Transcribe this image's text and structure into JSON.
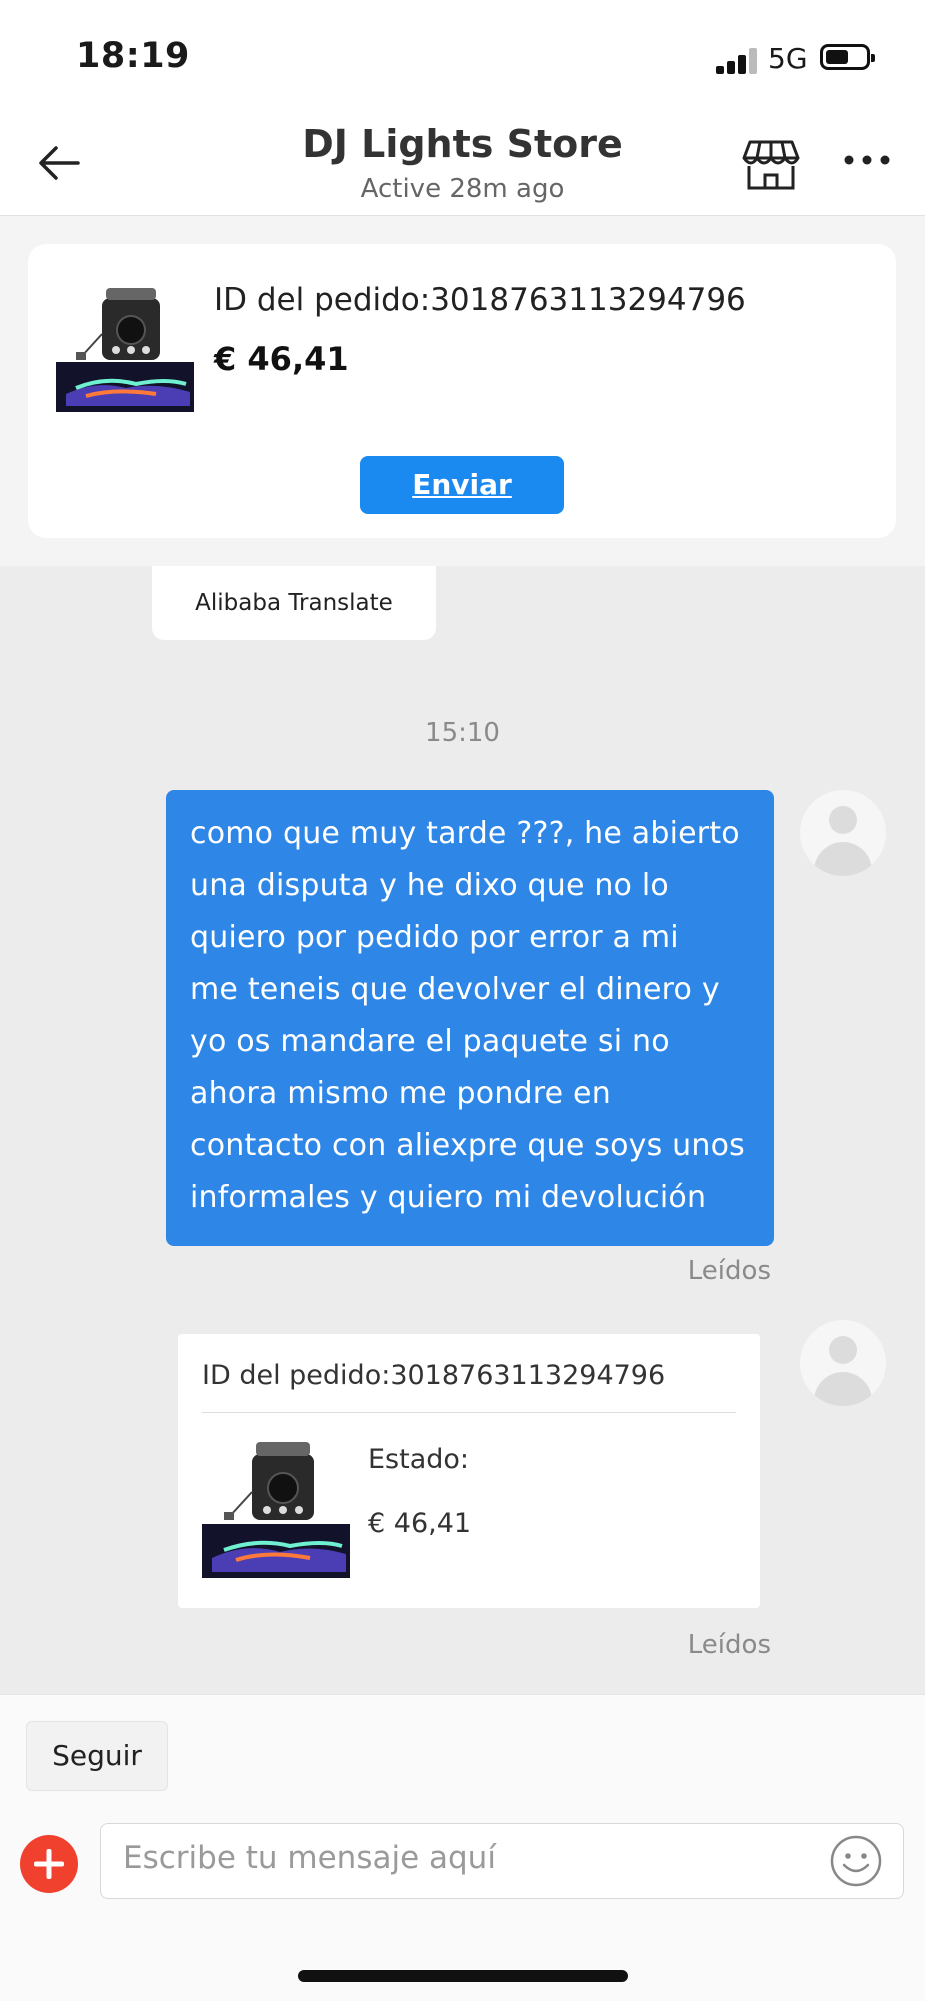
{
  "status": {
    "time": "18:19",
    "network": "5G"
  },
  "header": {
    "title": "DJ Lights Store",
    "subtitle": "Active 28m ago",
    "icons": [
      "back-arrow-icon",
      "store-icon",
      "more-dots-icon"
    ]
  },
  "order_card": {
    "order_id": "ID del pedido:3018763113294796",
    "price": "€ 46,41",
    "send_label": "Enviar"
  },
  "translate_label": "Alibaba Translate",
  "chat": {
    "timestamp": "15:10",
    "message_lines": [
      "como que muy tarde ???, he abierto",
      "una disputa y he dixo que no lo",
      "quiero por pedido por error a mi",
      "me teneis que devolver el dinero y",
      "yo os mandare el paquete si no",
      "ahora mismo me pondre en",
      "contacto con aliexpre que soys unos",
      "informales y quiero mi devolución"
    ],
    "read_1": "Leídos",
    "order_message": {
      "order_id": "ID del pedido:3018763113294796",
      "estado": "Estado:",
      "price": "€ 46,41"
    },
    "read_2": "Leídos"
  },
  "footer": {
    "follow_label": "Seguir",
    "input_placeholder": "Escribe tu mensaje aquí"
  },
  "colors": {
    "accent": "#1a8af0",
    "bubble": "#2e86e6",
    "add": "#f0412f"
  }
}
